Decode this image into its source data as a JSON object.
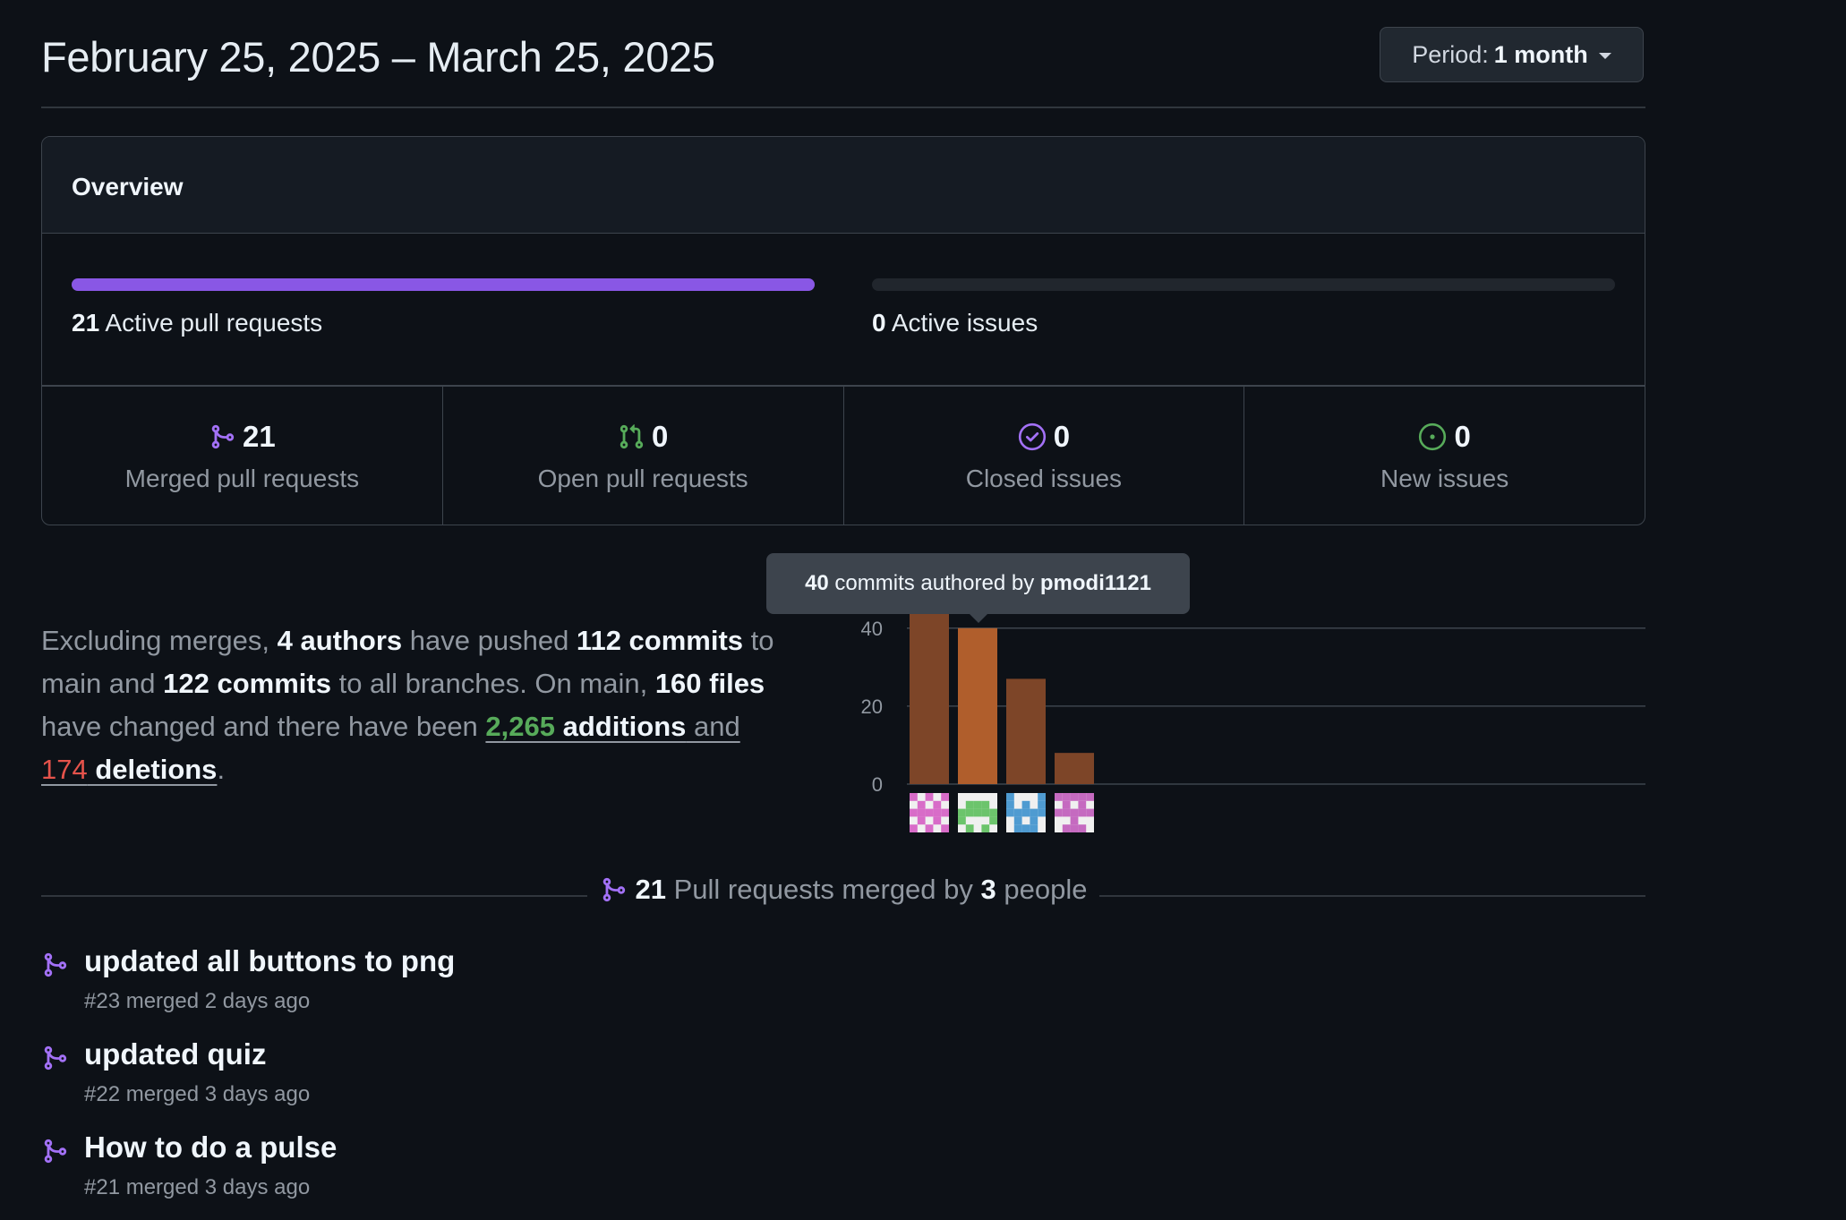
{
  "header": {
    "date_range": "February 25, 2025 – March 25, 2025",
    "period_label": "Period:",
    "period_value": "1 month"
  },
  "overview": {
    "title": "Overview",
    "active_pull_requests": {
      "count": "21",
      "label": "Active pull requests",
      "fill_fraction": 1.0
    },
    "active_issues": {
      "count": "0",
      "label": "Active issues",
      "fill_fraction": 0.0
    },
    "stats": [
      {
        "icon": "git-merge-icon",
        "value": "21",
        "label": "Merged pull requests",
        "color": "#a371f7"
      },
      {
        "icon": "git-pull-request-icon",
        "value": "0",
        "label": "Open pull requests",
        "color": "#57ab5a"
      },
      {
        "icon": "issue-closed-icon",
        "value": "0",
        "label": "Closed issues",
        "color": "#a371f7"
      },
      {
        "icon": "issue-opened-icon",
        "value": "0",
        "label": "New issues",
        "color": "#57ab5a"
      }
    ]
  },
  "summary": {
    "p1": "Excluding merges, ",
    "authors": "4 authors",
    "p2": " have pushed ",
    "commits_main": "112 commits",
    "p3": " to main and ",
    "commits_all": "122 commits",
    "p4": " to all branches. On main, ",
    "files": "160 files",
    "p5": " have changed and there have been ",
    "additions_num": "2,265",
    "additions_word": " additions",
    "p6": " and ",
    "deletions_num": "174",
    "deletions_word": " deletions",
    "p7": "."
  },
  "tooltip": {
    "count": "40",
    "text": " commits authored by ",
    "user": "pmodi1121"
  },
  "chart_data": {
    "type": "bar",
    "categories": [
      "author-1",
      "author-2",
      "author-3",
      "author-4"
    ],
    "values": [
      45,
      40,
      27,
      8
    ],
    "highlighted_index": 1,
    "ylim": [
      0,
      45
    ],
    "yticks": [
      0,
      20,
      40
    ],
    "grid": true,
    "colors": {
      "bar": "#7d4528",
      "bar_highlight": "#b05e2c",
      "grid": "#3d444d",
      "tick": "#9198a1"
    }
  },
  "pr_section": {
    "count": "21",
    "text1": " Pull requests merged by ",
    "people": "3",
    "text2": " people"
  },
  "pull_requests": [
    {
      "title": "updated all buttons to png",
      "meta": "#23 merged 2 days ago"
    },
    {
      "title": "updated quiz",
      "meta": "#22 merged 3 days ago"
    },
    {
      "title": "How to do a pulse",
      "meta": "#21 merged 3 days ago"
    }
  ]
}
